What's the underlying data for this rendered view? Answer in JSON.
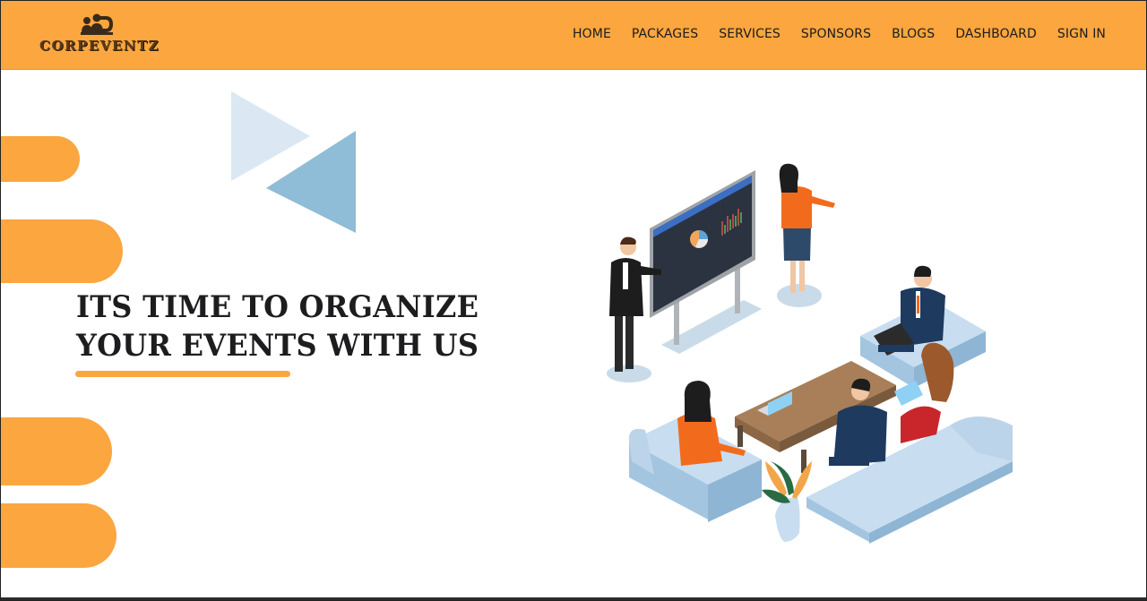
{
  "brand": {
    "name": "CORPEVENTZ"
  },
  "nav": {
    "items": [
      {
        "label": "HOME"
      },
      {
        "label": "PACKAGES"
      },
      {
        "label": "SERVICES"
      },
      {
        "label": "SPONSORS"
      },
      {
        "label": "BLOGS"
      },
      {
        "label": "DASHBOARD"
      },
      {
        "label": "SIGN IN"
      }
    ]
  },
  "hero": {
    "title_line1": "ITS TIME TO ORGANIZE",
    "title_line2": "YOUR EVENTS WITH US"
  },
  "colors": {
    "accent": "#fba63f",
    "text_dark": "#1d1d1f",
    "triangle_light": "#dbe8f4",
    "triangle_dark": "#8fbcd6"
  },
  "icons": [
    "corpeventz-logo-icon"
  ]
}
